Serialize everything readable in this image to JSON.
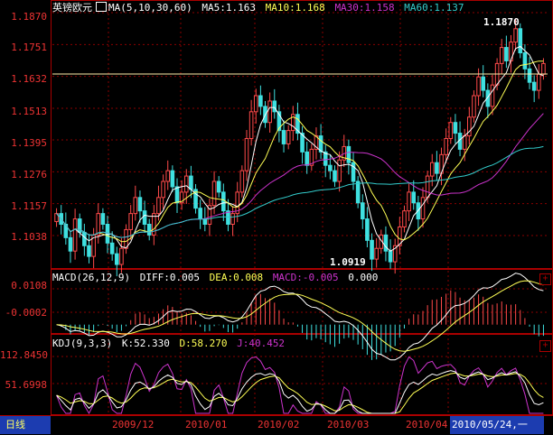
{
  "colors": {
    "bg": "#000000",
    "grid": "#8a0000",
    "axis": "#e03030",
    "up": "#ff4a4a",
    "down": "#3fe0e0",
    "ma5": "#ffffff",
    "ma10": "#ffff55",
    "ma30": "#cc33cc",
    "ma60": "#33cccc",
    "macd_pos": "#ff4a4a",
    "macd_neg": "#3fe0e0",
    "tab_bg": "#1c3cb0",
    "tab_text": "#ffff66"
  },
  "price_legend": {
    "symbol": "英镑欧元",
    "ma_label": "MA(5,10,30,60)",
    "ma5": "MA5:1.163",
    "ma10": "MA10:1.168",
    "ma30": "MA30:1.158",
    "ma60": "MA60:1.137"
  },
  "price_axis": [
    "1.1870",
    "1.1751",
    "1.1632",
    "1.1513",
    "1.1395",
    "1.1276",
    "1.1157",
    "1.1038"
  ],
  "price_annotations": {
    "high": "1.1870",
    "low": "1.0919"
  },
  "macd_legend": {
    "label": "MACD(26,12,9)",
    "diff": "DIFF:0.005",
    "dea": "DEA:0.008",
    "macd": "MACD:-0.005",
    "extra": "0.000"
  },
  "macd_axis": [
    "0.0108",
    "-0.0002"
  ],
  "kdj_legend": {
    "label": "KDJ(9,3,3)",
    "k": "K:52.330",
    "d": "D:58.270",
    "j": "J:40.452"
  },
  "kdj_axis": [
    "112.8450",
    "51.6998"
  ],
  "x_labels": [
    "2009/12",
    "2010/01",
    "2010/02",
    "2010/03",
    "2010/04"
  ],
  "bottom": {
    "period_tab": "日线",
    "cursor_date": "2010/05/24,一"
  },
  "panel_buttons": {
    "plus": "+"
  },
  "chart_data": {
    "type": "candlestick",
    "x": [
      "2009/12",
      "2010/01",
      "2010/02",
      "2010/03",
      "2010/04",
      "2010/05"
    ],
    "ylim": [
      1.092,
      1.187
    ],
    "y_ticks": [
      1.187,
      1.1751,
      1.1632,
      1.1513,
      1.1395,
      1.1276,
      1.1157,
      1.1038
    ],
    "close": [
      1.112,
      1.108,
      1.103,
      1.098,
      1.11,
      1.105,
      1.1,
      1.096,
      1.104,
      1.112,
      1.108,
      1.101,
      1.097,
      1.093,
      1.099,
      1.106,
      1.112,
      1.118,
      1.113,
      1.108,
      1.104,
      1.112,
      1.118,
      1.124,
      1.128,
      1.122,
      1.116,
      1.12,
      1.126,
      1.121,
      1.114,
      1.11,
      1.108,
      1.115,
      1.124,
      1.12,
      1.113,
      1.108,
      1.112,
      1.12,
      1.128,
      1.14,
      1.15,
      1.156,
      1.152,
      1.146,
      1.154,
      1.15,
      1.143,
      1.138,
      1.143,
      1.149,
      1.142,
      1.135,
      1.13,
      1.136,
      1.141,
      1.135,
      1.13,
      1.128,
      1.124,
      1.132,
      1.137,
      1.131,
      1.124,
      1.116,
      1.11,
      1.102,
      1.095,
      1.099,
      1.104,
      1.098,
      1.094,
      1.1,
      1.107,
      1.113,
      1.12,
      1.116,
      1.11,
      1.118,
      1.126,
      1.131,
      1.127,
      1.134,
      1.14,
      1.146,
      1.142,
      1.136,
      1.141,
      1.148,
      1.156,
      1.163,
      1.158,
      1.152,
      1.16,
      1.168,
      1.174,
      1.169,
      1.176,
      1.181,
      1.172,
      1.166,
      1.161,
      1.158,
      1.164,
      1.168
    ],
    "ma5_last": 1.163,
    "ma10_last": 1.168,
    "ma30_last": 1.158,
    "ma60_last": 1.137,
    "macd": {
      "diff": 0.005,
      "dea": 0.008,
      "macd": -0.005,
      "ylim": [
        -0.002,
        0.0115
      ]
    },
    "kdj": {
      "k": 52.33,
      "d": 58.27,
      "j": 40.452,
      "ylim": [
        20,
        125
      ]
    }
  }
}
